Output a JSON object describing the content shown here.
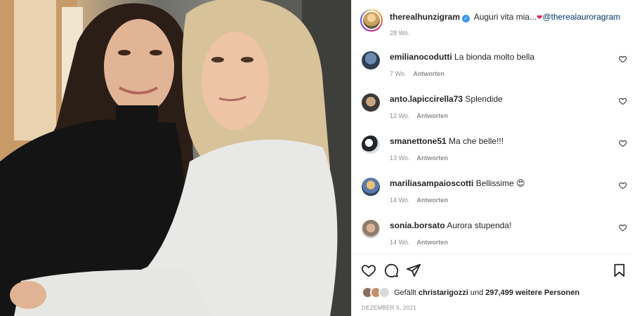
{
  "post": {
    "author": "therealhunzigram",
    "caption_text": "Auguri vita mia...",
    "caption_heart": "❤",
    "mention": "@therealauroragram",
    "time": "28 Wo."
  },
  "comments": [
    {
      "user": "emilianocodutti",
      "text": "La bionda molto bella",
      "time": "7 Wo.",
      "reply": "Antworten"
    },
    {
      "user": "anto.lapiccirella73",
      "text": "Splendide",
      "time": "12 Wo.",
      "reply": "Antworten"
    },
    {
      "user": "smanettone51",
      "text": "Ma che belle!!!",
      "time": "13 Wo.",
      "reply": "Antworten"
    },
    {
      "user": "mariliasampaioscotti",
      "text": "Bellissime 😍",
      "time": "14 Wo.",
      "reply": "Antworten"
    },
    {
      "user": "sonia.borsato",
      "text": "Aurora stupenda!",
      "time": "14 Wo.",
      "reply": "Antworten"
    }
  ],
  "likes": {
    "prefix": "Gefällt",
    "user": "christarigozzi",
    "middle": "und",
    "count": "297,499 weitere Personen"
  },
  "date": "DEZEMBER 5, 2021",
  "icons": {
    "like": "heart-icon",
    "comment": "comment-bubble-icon",
    "share": "paper-plane-icon",
    "save": "bookmark-icon",
    "verified": "verified-badge-icon"
  },
  "colors": {
    "link": "#00376b",
    "verified": "#3897f0",
    "muted": "#8e8e8e"
  }
}
